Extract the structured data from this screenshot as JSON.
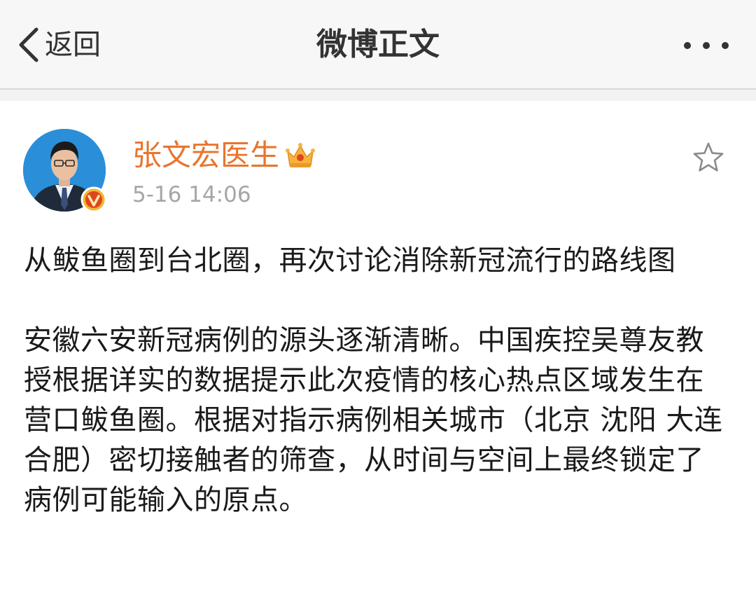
{
  "navbar": {
    "back_label": "返回",
    "title": "微博正文"
  },
  "post": {
    "author": "张文宏医生",
    "time": "5-16 14:06",
    "paragraphs": [
      "从鲅鱼圈到台北圈，再次讨论消除新冠流行的路线图",
      "安徽六安新冠病例的源头逐渐清晰。中国疾控吴尊友教授根据详实的数据提示此次疫情的核心热点区域发生在营口鲅鱼圈。根据对指示病例相关城市（北京 沈阳 大连 合肥）密切接触者的筛查，从时间与空间上最终锁定了病例可能输入的原点。"
    ]
  },
  "colors": {
    "author": "#e8752e",
    "time": "#a6a6a6",
    "navbar_bg": "#f7f7f7",
    "text": "#1a1a1a"
  },
  "icons": {
    "back": "chevron-left-icon",
    "more": "more-dots-icon",
    "crown": "crown-icon",
    "verified": "verified-v-icon",
    "favorite": "star-icon"
  }
}
